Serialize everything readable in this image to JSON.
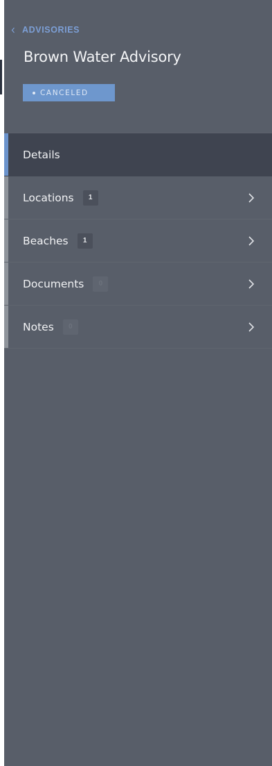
{
  "header": {
    "back_label": "ADVISORIES",
    "title": "Brown Water Advisory",
    "status": "CANCELED"
  },
  "nav": {
    "details": {
      "label": "Details"
    },
    "locations": {
      "label": "Locations",
      "count": "1"
    },
    "beaches": {
      "label": "Beaches",
      "count": "1"
    },
    "documents": {
      "label": "Documents",
      "count": "0"
    },
    "notes": {
      "label": "Notes",
      "count": "0"
    }
  },
  "icons": {
    "back": "chevron-left-icon",
    "forward": "chevron-right-icon",
    "status": "dot-icon"
  },
  "colors": {
    "panel": "#585e69",
    "active_item": "#3f4450",
    "accent": "#6b93cc",
    "link": "#7c9fd6",
    "status_badge": "#6e97cd"
  }
}
